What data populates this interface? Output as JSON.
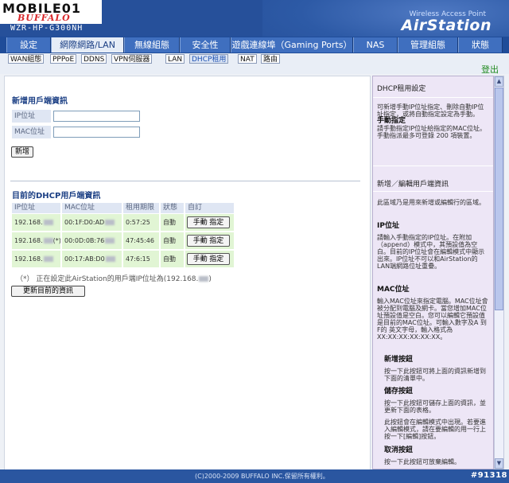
{
  "brand": {
    "site": "MOBILE01",
    "logo_text": "BUFFALO",
    "model": "WZR-HP-G300NH",
    "product_tag": "Wireless Access Point",
    "product_name": "AirStation"
  },
  "nav": {
    "items": [
      "設定",
      "網際網路/LAN",
      "無線組態",
      "安全性",
      "遊戲連線埠（Gaming Ports）",
      "NAS",
      "管理組態",
      "狀態"
    ],
    "active": "網際網路/LAN"
  },
  "subnav": {
    "items": [
      "WAN組態",
      "PPPoE",
      "DDNS",
      "VPN伺服器",
      "LAN",
      "DHCP租用",
      "NAT",
      "路由"
    ],
    "active": "DHCP租用"
  },
  "logout_label": "登出",
  "add_client": {
    "title": "新增用戶端資訊",
    "ip_label": "IP位址",
    "mac_label": "MAC位址",
    "ip_value": "",
    "mac_value": "",
    "add_button": "新增"
  },
  "current_clients": {
    "title": "目前的DHCP用戶端資訊",
    "columns": [
      "IP位址",
      "MAC位址",
      "租用期限",
      "狀態",
      "自訂"
    ],
    "rows": [
      {
        "ip": "192.168.",
        "ip_suffix": "",
        "mac": "00:1F:D0:AD",
        "lease": "0:57:25",
        "status": "自動",
        "action": "手動 指定"
      },
      {
        "ip": "192.168.",
        "ip_suffix": "(*)",
        "mac": "00:0D:0B:76",
        "lease": "47:45:46",
        "status": "自動",
        "action": "手動 指定"
      },
      {
        "ip": "192.168.",
        "ip_suffix": "",
        "mac": "00:17:AB:D0",
        "lease": "47:6:15",
        "status": "自動",
        "action": "手動 指定"
      }
    ],
    "note_prefix": "（*） 正在設定此AirStation的用戶端IP位址為(192.168.",
    "note_suffix": ")",
    "refresh_button": "更新目前的資訊"
  },
  "help": {
    "title": "DHCP租用設定",
    "intro": "可新增手動IP位址指定、刪除自動IP位址指定，或將自動指定設定為手動。",
    "manual_label": "手動指定",
    "manual_text": "請手動指定IP位址給指定的MAC位址。",
    "manual_limit": "手動指派最多可登錄 200 項裝置。",
    "edit_title": "新增／編輯用戶端資訊",
    "edit_text": "此區域乃是用來新增或編輯行的區域。",
    "ip_title": "IP位址",
    "ip_text": "請輸入手動指定的IP位址。在附加（append）模式中，其預設值為空白。目前的IP位址會在編輯模式中顯示出來。IP位址不可以和AirStation的LAN端網路位址重疊。",
    "mac_title": "MAC位址",
    "mac_text": "輸入MAC位址來指定電腦。MAC位址會被分配到電腦及網卡。當您增加MAC位址預設值是空白。您可以編輯它預設值是目前的MAC位址。可輸入數字及A 到F的 英文字母，輸入格式為XX:XX:XX:XX:XX:XX。",
    "new_btn_title": "新增按鈕",
    "new_btn_text": "按一下此按鈕可將上面的資訊新增到下面的清單中。",
    "save_btn_title": "儲存按鈕",
    "save_btn_text": "按一下此按鈕可儲存上面的資訊，並更新下面的表格。",
    "edit_btn_text": "此按鈕會在編輯模式中出現。若要進入編輯模式，請在要編輯的用一行上按一下[編輯]按鈕。",
    "cancel_btn_title": "取消按鈕",
    "cancel_btn_text": "按一下此按鈕可放棄編輯。"
  },
  "footer": "(C)2000-2009 BUFFALO INC.保留所有權利。",
  "watermark": "#91318"
}
